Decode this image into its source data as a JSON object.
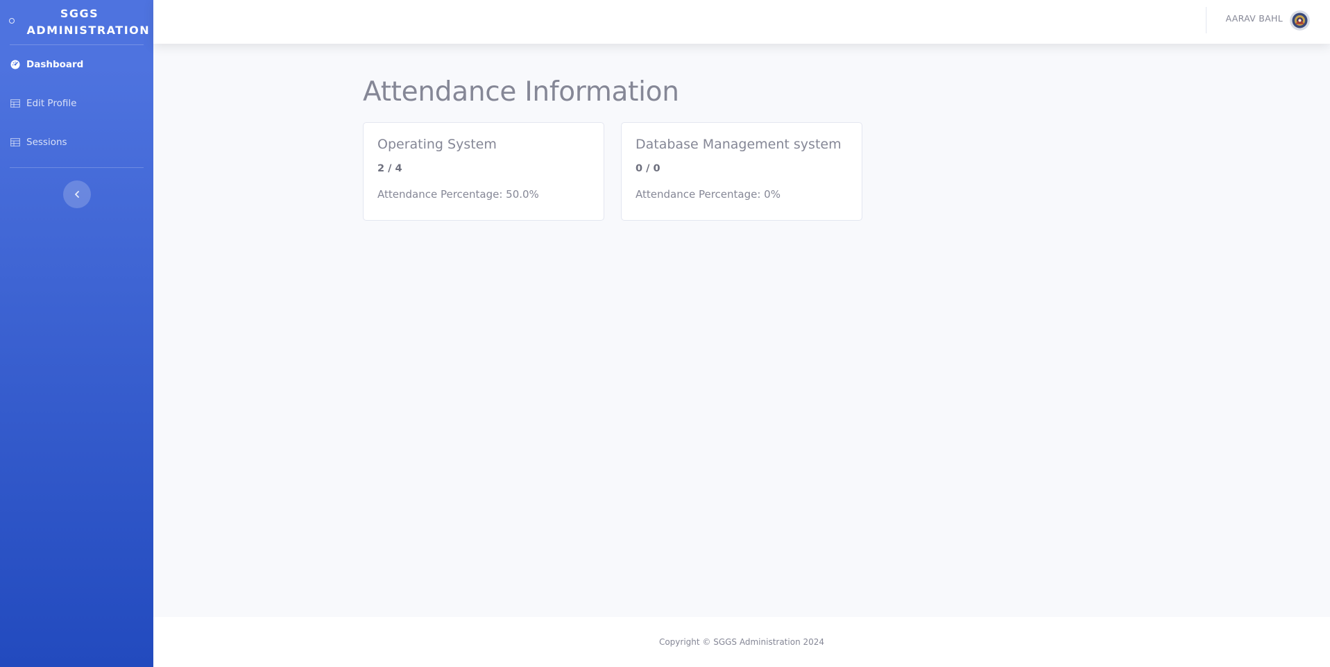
{
  "sidebar": {
    "brand": "SGGS ADMINISTRATION",
    "items": [
      {
        "label": "Dashboard",
        "icon": "tachometer-icon",
        "active": true
      },
      {
        "label": "Edit Profile",
        "icon": "table-icon",
        "active": false
      },
      {
        "label": "Sessions",
        "icon": "table-icon",
        "active": false
      }
    ],
    "toggle_icon": "chevron-left-icon"
  },
  "topbar": {
    "user_name": "AARAV BAHL",
    "avatar_icon": "user-avatar"
  },
  "main": {
    "title": "Attendance Information",
    "cards": [
      {
        "subject": "Operating System",
        "count": "2 / 4",
        "percentage": "Attendance Percentage: 50.0%"
      },
      {
        "subject": "Database Management system",
        "count": "0 / 0",
        "percentage": "Attendance Percentage: 0%"
      }
    ]
  },
  "footer": {
    "copyright": "Copyright © SGGS Administration 2024"
  },
  "colors": {
    "sidebar_top": "#4e73df",
    "sidebar_bottom": "#224abe",
    "background": "#f8f9fc",
    "text_muted": "#858796"
  }
}
